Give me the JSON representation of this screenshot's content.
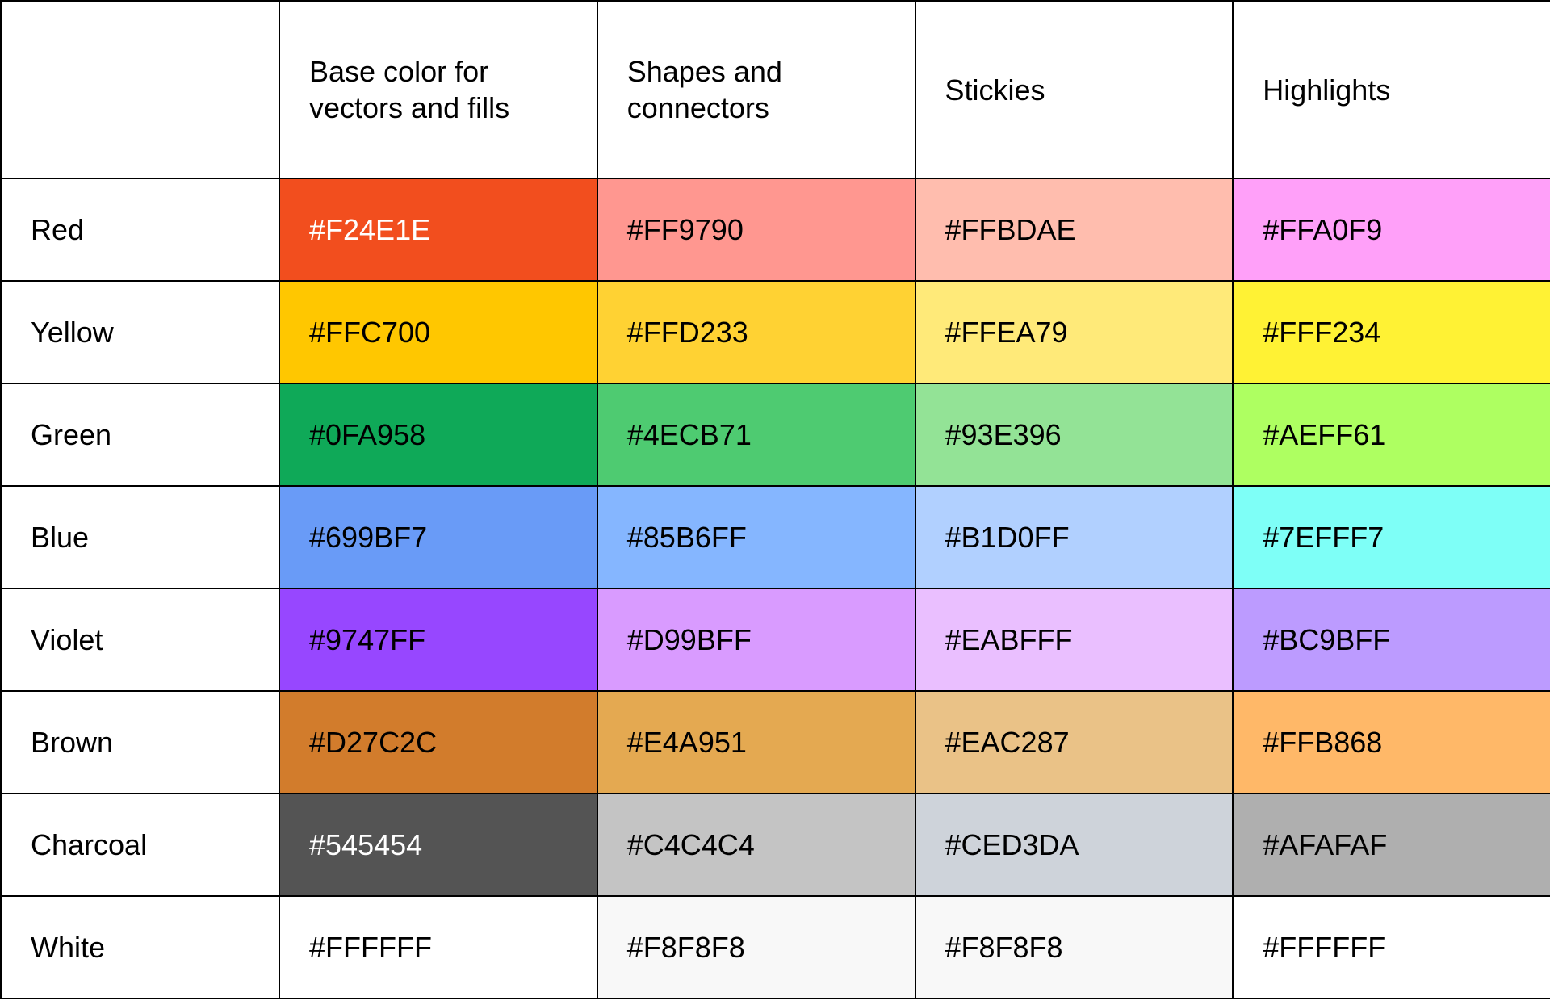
{
  "table": {
    "columns": [
      "",
      "Base color for vectors and fills",
      "Shapes and connectors",
      "Stickies",
      "Highlights"
    ],
    "rows": [
      {
        "name": "Red",
        "cells": [
          {
            "hex": "#F24E1E",
            "text_light": true
          },
          {
            "hex": "#FF9790",
            "text_light": false
          },
          {
            "hex": "#FFBDAE",
            "text_light": false
          },
          {
            "hex": "#FFA0F9",
            "text_light": false
          }
        ]
      },
      {
        "name": "Yellow",
        "cells": [
          {
            "hex": "#FFC700",
            "text_light": false
          },
          {
            "hex": "#FFD233",
            "text_light": false
          },
          {
            "hex": "#FFEA79",
            "text_light": false
          },
          {
            "hex": "#FFF234",
            "text_light": false
          }
        ]
      },
      {
        "name": "Green",
        "cells": [
          {
            "hex": "#0FA958",
            "text_light": false
          },
          {
            "hex": "#4ECB71",
            "text_light": false
          },
          {
            "hex": "#93E396",
            "text_light": false
          },
          {
            "hex": "#AEFF61",
            "text_light": false
          }
        ]
      },
      {
        "name": "Blue",
        "cells": [
          {
            "hex": "#699BF7",
            "text_light": false
          },
          {
            "hex": "#85B6FF",
            "text_light": false
          },
          {
            "hex": "#B1D0FF",
            "text_light": false
          },
          {
            "hex": "#7EFFF7",
            "text_light": false
          }
        ]
      },
      {
        "name": "Violet",
        "cells": [
          {
            "hex": "#9747FF",
            "text_light": false
          },
          {
            "hex": "#D99BFF",
            "text_light": false
          },
          {
            "hex": "#EABFFF",
            "text_light": false
          },
          {
            "hex": "#BC9BFF",
            "text_light": false
          }
        ]
      },
      {
        "name": "Brown",
        "cells": [
          {
            "hex": "#D27C2C",
            "text_light": false
          },
          {
            "hex": "#E4A951",
            "text_light": false
          },
          {
            "hex": "#EAC287",
            "text_light": false
          },
          {
            "hex": "#FFB868",
            "text_light": false
          }
        ]
      },
      {
        "name": "Charcoal",
        "cells": [
          {
            "hex": "#545454",
            "text_light": true
          },
          {
            "hex": "#C4C4C4",
            "text_light": false
          },
          {
            "hex": "#CED3DA",
            "text_light": false
          },
          {
            "hex": "#AFAFAF",
            "text_light": false
          }
        ]
      },
      {
        "name": "White",
        "cells": [
          {
            "hex": "#FFFFFF",
            "text_light": false
          },
          {
            "hex": "#F8F8F8",
            "text_light": false
          },
          {
            "hex": "#F8F8F8",
            "text_light": false
          },
          {
            "hex": "#FFFFFF",
            "text_light": false
          }
        ]
      }
    ]
  }
}
